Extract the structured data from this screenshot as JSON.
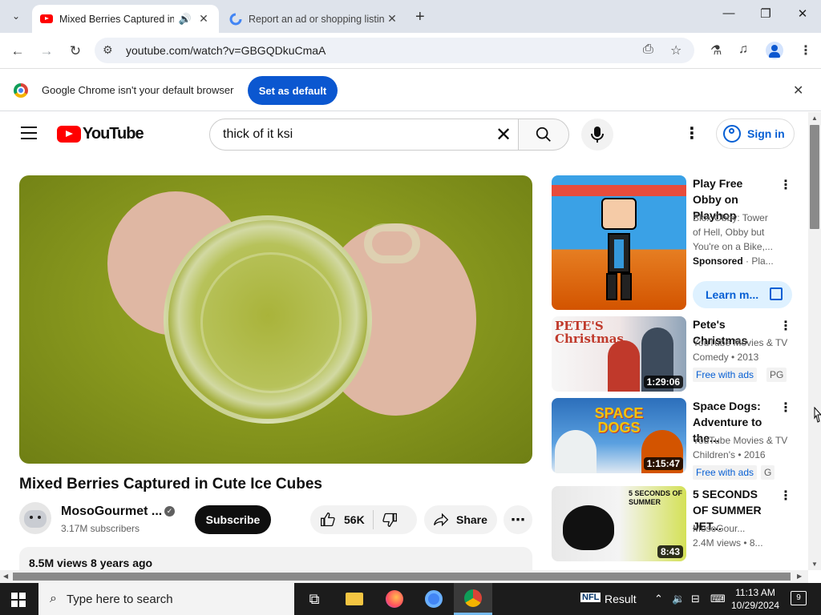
{
  "browser": {
    "tabs": [
      {
        "title": "Mixed Berries Captured in C",
        "audio": "🔊"
      },
      {
        "title": "Report an ad or shopping listin"
      }
    ],
    "url": "youtube.com/watch?v=GBGQDkuCmaA",
    "infobar": {
      "message": "Google Chrome isn't your default browser",
      "button": "Set as default"
    }
  },
  "youtube": {
    "logo_text": "YouTube",
    "search_query": "thick of it ksi",
    "sign_in": "Sign in",
    "video": {
      "title": "Mixed Berries Captured in Cute Ice Cubes",
      "channel": "MosoGourmet ...",
      "subscribers": "3.17M subscribers",
      "subscribe": "Subscribe",
      "likes": "56K",
      "share": "Share",
      "views_date": "8.5M views  8 years ago"
    },
    "recommendations": [
      {
        "title": "Play Free Obby on Playhop",
        "meta": [
          "Blox Obby: Tower",
          "of Hell, Obby but",
          "You're on a Bike,..."
        ],
        "sponsored": "Sponsored",
        "sponsored_suffix": "· Pla...",
        "learn_more": "Learn m..."
      },
      {
        "title": "Pete's Christmas",
        "meta": [
          "YouTube Movies & TV",
          "Comedy • 2013"
        ],
        "duration": "1:29:06",
        "badge1": "Free with ads",
        "badge2": "PG",
        "thumb_text": "PETE'S Christmas"
      },
      {
        "title": "Space Dogs: Adventure to the...",
        "meta": [
          "YouTube Movies & TV",
          "Children's • 2016"
        ],
        "duration": "1:15:47",
        "badge1": "Free with ads",
        "badge2": "G",
        "thumb_text": "SPACE DOGS"
      },
      {
        "title": "5 SECONDS OF SUMMER JET...",
        "meta": [
          "MosoGour...",
          "2.4M views • 8..."
        ],
        "duration": "8:43",
        "thumb_text": "5 SECONDS OF SUMMER"
      }
    ]
  },
  "taskbar": {
    "search_placeholder": "Type here to search",
    "tray_label": "Result",
    "time": "11:13 AM",
    "date": "10/29/2024",
    "notifications": "9"
  },
  "colors": {
    "youtube_red": "#ff0000",
    "chrome_blue": "#0b57d0",
    "link_blue": "#065fd4"
  },
  "icons": [
    "search-icon",
    "mic-icon",
    "close-icon",
    "reload-icon",
    "back-icon",
    "forward-icon",
    "star-icon",
    "like-icon",
    "dislike-icon",
    "share-icon",
    "windows-icon"
  ]
}
